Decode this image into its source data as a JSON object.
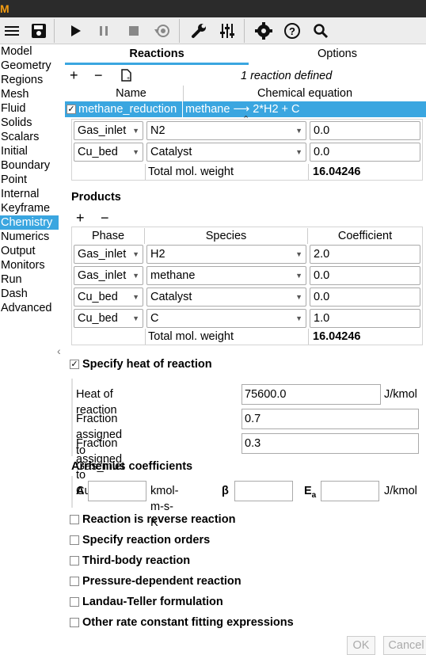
{
  "app": {
    "logo": "M"
  },
  "nav": {
    "items": [
      "Model",
      "Geometry",
      "Regions",
      "Mesh",
      "Fluid",
      "Solids",
      "Scalars",
      "Initial",
      "Boundary",
      "Point",
      "Internal",
      "Keyframe",
      "Chemistry",
      "Numerics",
      "Output",
      "Monitors",
      "Run",
      "Dash",
      "Advanced"
    ],
    "active": "Chemistry"
  },
  "tabs": {
    "reactions": "Reactions",
    "options": "Options"
  },
  "reaction_list": {
    "count_text": "1 reaction defined",
    "col_name": "Name",
    "col_equation": "Chemical equation",
    "row": {
      "checked": "✓",
      "name": "methane_reduction",
      "equation": "methane ⟶ 2*H2 + C"
    }
  },
  "reactants_partial": {
    "rows": [
      {
        "phase": "Gas_inlet",
        "species": "N2",
        "coefficient": "0.0"
      },
      {
        "phase": "Cu_bed",
        "species": "Catalyst",
        "coefficient": "0.0"
      }
    ],
    "total_label": "Total mol. weight",
    "total_value": "16.04246"
  },
  "products": {
    "title": "Products",
    "col_phase": "Phase",
    "col_species": "Species",
    "col_coefficient": "Coefficient",
    "rows": [
      {
        "phase": "Gas_inlet",
        "species": "H2",
        "coefficient": "2.0"
      },
      {
        "phase": "Gas_inlet",
        "species": "methane",
        "coefficient": "0.0"
      },
      {
        "phase": "Cu_bed",
        "species": "Catalyst",
        "coefficient": "0.0"
      },
      {
        "phase": "Cu_bed",
        "species": "C",
        "coefficient": "1.0"
      }
    ],
    "total_label": "Total mol. weight",
    "total_value": "16.04246"
  },
  "heat": {
    "checkbox_label": "Specify heat of reaction",
    "heat_label": "Heat of reaction",
    "heat_value": "75600.0",
    "heat_unit": "J/kmol",
    "frac_gas_label": "Fraction assigned to Gas_inlet",
    "frac_gas_value": "0.7",
    "frac_cu_label": "Fraction assigned to Cu_bed",
    "frac_cu_value": "0.3"
  },
  "arrhenius": {
    "title": "Arrhenius coefficients",
    "a_label": "A",
    "a_unit": "kmol-m-s-K",
    "beta_label": "β",
    "ea_label": "E",
    "ea_sub": "a",
    "ea_unit": "J/kmol"
  },
  "options": [
    "Reaction is reverse reaction",
    "Specify reaction orders",
    "Third-body reaction",
    "Pressure-dependent reaction",
    "Landau-Teller formulation",
    "Other rate constant fitting expressions"
  ],
  "buttons": {
    "ok": "OK",
    "cancel": "Cancel"
  },
  "colors": {
    "accent": "#3aa6e0",
    "titlebar": "#2b2b2b",
    "logo": "#f39c12"
  }
}
